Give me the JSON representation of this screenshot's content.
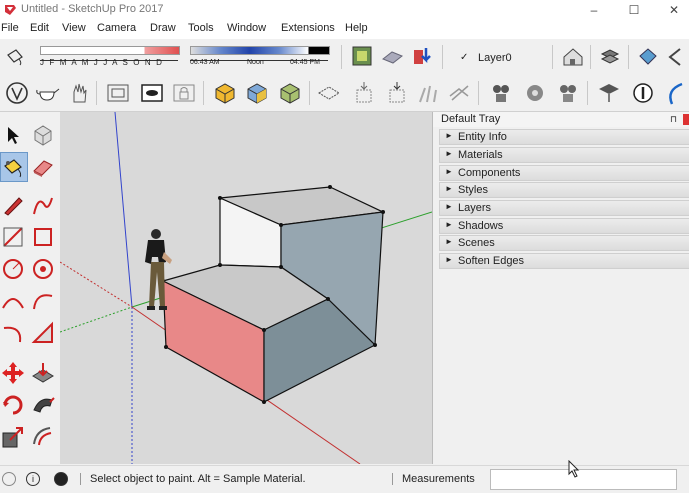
{
  "window": {
    "title": "Untitled - SketchUp Pro 2017",
    "minimize": "–",
    "maximize": "☐",
    "close": "✕"
  },
  "menu": [
    "File",
    "Edit",
    "View",
    "Camera",
    "Draw",
    "Tools",
    "Window",
    "Extensions",
    "Help"
  ],
  "shadow_settings": {
    "months": "J F M A M J J A S O N D",
    "time_start": "06:43 AM",
    "time_noon": "Noon",
    "time_end": "04:45 PM"
  },
  "layer": {
    "name": "Layer0",
    "check": "✓"
  },
  "tray": {
    "title": "Default Tray",
    "pin": "⊓",
    "panels": [
      "Entity Info",
      "Materials",
      "Components",
      "Styles",
      "Layers",
      "Shadows",
      "Scenes",
      "Soften Edges"
    ]
  },
  "status": {
    "message": "Select object to paint. Alt = Sample Material.",
    "measurements_label": "Measurements",
    "measurements_value": ""
  },
  "icons": {
    "info1": "i",
    "info2": "i"
  }
}
